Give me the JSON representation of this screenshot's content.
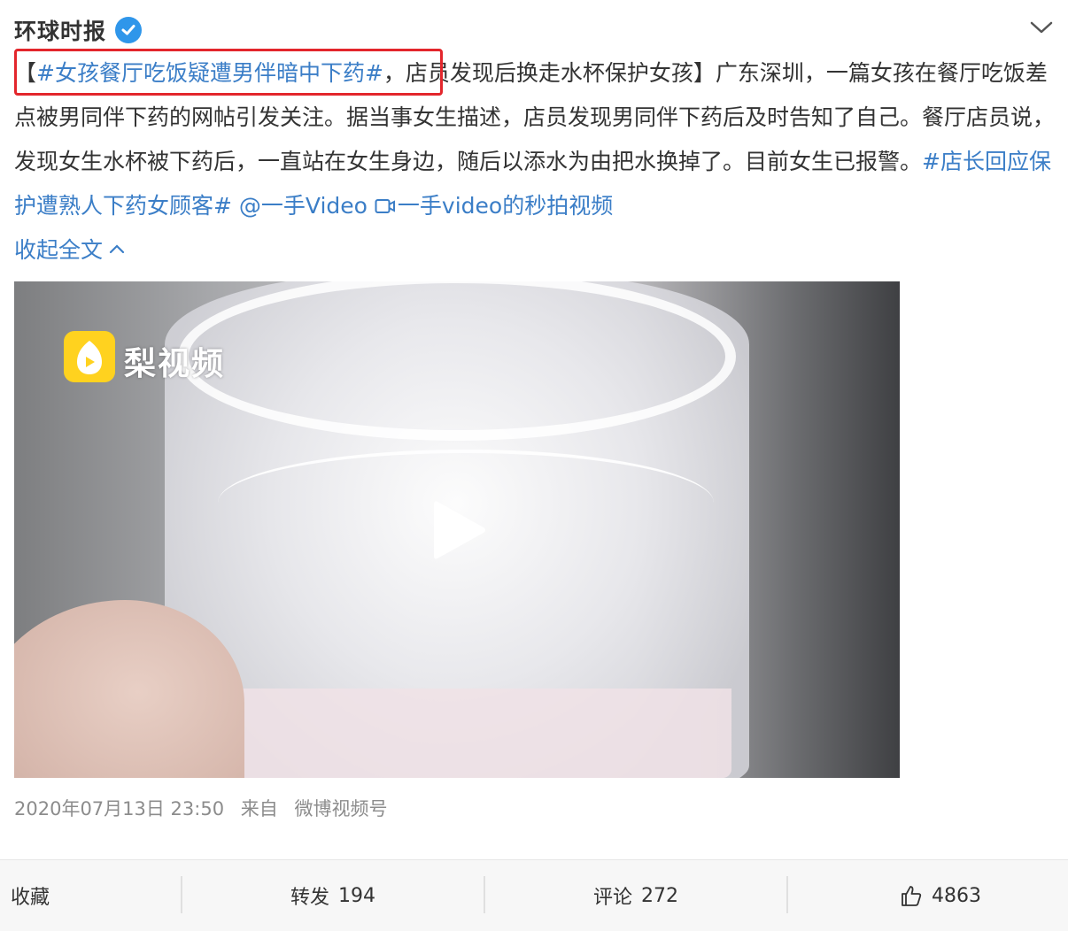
{
  "header": {
    "author": "环球时报",
    "verified_icon": "verified-badge-icon",
    "menu_icon": "chevron-down-icon"
  },
  "post": {
    "bracket_open": "【",
    "topic_tag": "#女孩餐厅吃饭疑遭男伴暗中下药#",
    "text_1": "，店员发现后换走水杯保护女孩】广东深圳，一篇女孩在餐厅吃饭差点被男同伴下药的网帖引发关注。据当事女生描述，店员发现男同伴下药后及时告知了自己。餐厅店员说，发现女生水杯被下药后，一直站在女生身边，随后以添水为由把水换掉了。目前女生已报警。",
    "topic_tag_2": "#店长回应保护遭熟人下药女顾客#",
    "mention": "@一手Video",
    "video_link": "一手video的秒拍视频",
    "collapse_label": "收起全文"
  },
  "video": {
    "watermark_text": "梨视频",
    "play_icon": "play-icon"
  },
  "meta": {
    "timestamp": "2020年07月13日 23:50",
    "source_prefix": "来自",
    "source": "微博视频号"
  },
  "actions": {
    "favorite_label": "收藏",
    "repost_label": "转发",
    "repost_count": "194",
    "comment_label": "评论",
    "comment_count": "272",
    "like_count": "4863"
  },
  "colors": {
    "link": "#3b7ec7",
    "highlight_box": "#e3262c",
    "verified": "#2f96ea"
  }
}
